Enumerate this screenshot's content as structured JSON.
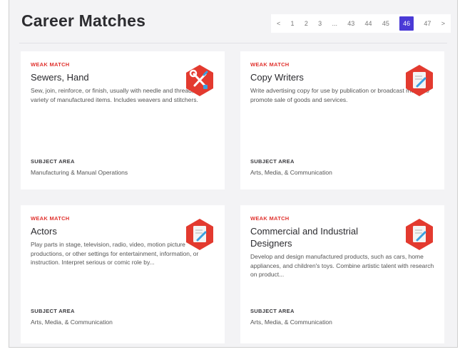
{
  "page": {
    "title": "Career Matches"
  },
  "pagination": {
    "prev": "<",
    "pages": [
      "1",
      "2",
      "3",
      "...",
      "43",
      "44",
      "45",
      "46",
      "47"
    ],
    "active": "46",
    "next": ">"
  },
  "colors": {
    "accent": "#e0322e",
    "active_page": "#4a3ad6"
  },
  "subject_label": "SUBJECT AREA",
  "cards": [
    {
      "match": "WEAK MATCH",
      "title": "Sewers, Hand",
      "description": "Sew, join, reinforce, or finish, usually with needle and thread, a variety of manufactured items. Includes weavers and stitchers.",
      "subject": "Manufacturing & Manual Operations",
      "icon": "tools-icon"
    },
    {
      "match": "WEAK MATCH",
      "title": "Copy Writers",
      "description": "Write advertising copy for use by publication or broadcast media to promote sale of goods and services.",
      "subject": "Arts, Media, & Communication",
      "icon": "document-pencil-icon"
    },
    {
      "match": "WEAK MATCH",
      "title": "Actors",
      "description": "Play parts in stage, television, radio, video, motion picture productions, or other settings for entertainment, information, or instruction. Interpret serious or comic role by...",
      "subject": "Arts, Media, & Communication",
      "icon": "document-pencil-icon"
    },
    {
      "match": "WEAK MATCH",
      "title": "Commercial and Industrial Designers",
      "description": "Develop and design manufactured products, such as cars, home appliances, and children's toys. Combine artistic talent with research on product...",
      "subject": "Arts, Media, & Communication",
      "icon": "document-pencil-icon"
    }
  ]
}
